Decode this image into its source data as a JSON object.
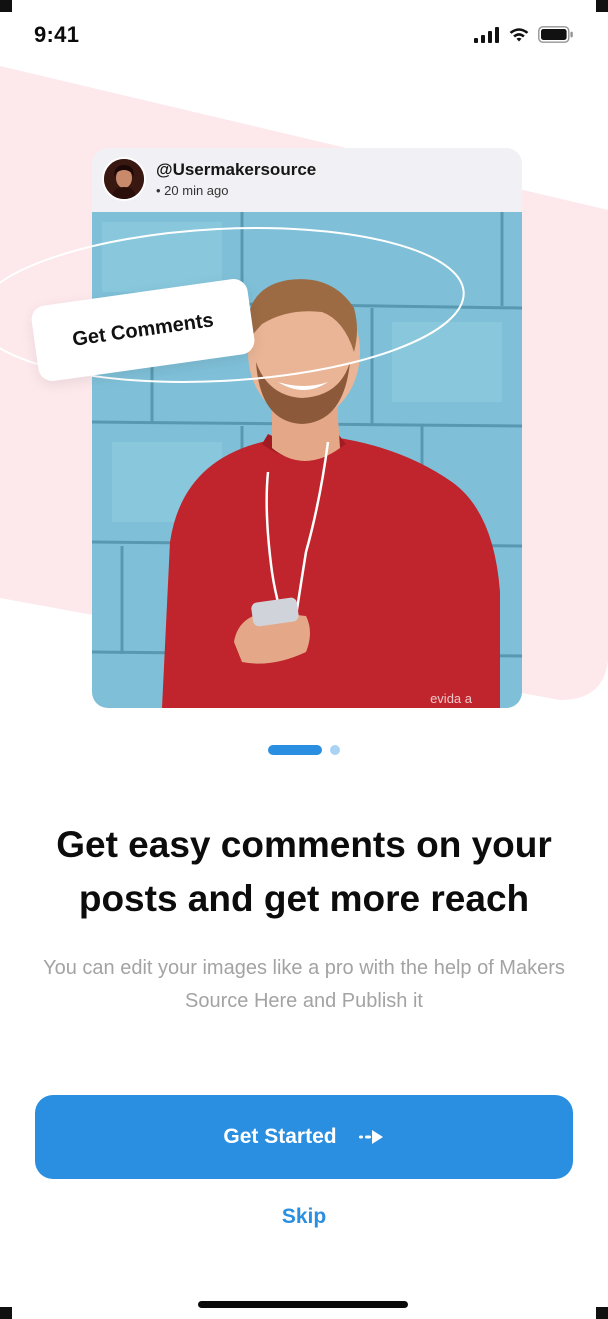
{
  "status_bar": {
    "time": "9:41",
    "signal_icon": "cellular-signal-icon",
    "wifi_icon": "wifi-icon",
    "battery_icon": "battery-icon"
  },
  "post": {
    "username": "@Usermakersource",
    "time_ago": "• 20 min ago",
    "photo_caption_fragment": "evida a",
    "tag_label": "Get Comments"
  },
  "pager": {
    "total_pages": 2,
    "active_page": 1
  },
  "content": {
    "headline": "Get easy comments on your posts and get more reach",
    "subtext": "You can edit your images like a pro with the help of Makers Source Here and Publish it"
  },
  "actions": {
    "primary_label": "Get Started",
    "primary_icon": "arrow-right-icon",
    "skip_label": "Skip"
  },
  "colors": {
    "accent": "#2A8FE0",
    "accent_light": "#A9D2F5",
    "pink_background": "#FDE8EC",
    "heading_text": "#0C0C0C",
    "body_text": "#A3A3A3"
  }
}
